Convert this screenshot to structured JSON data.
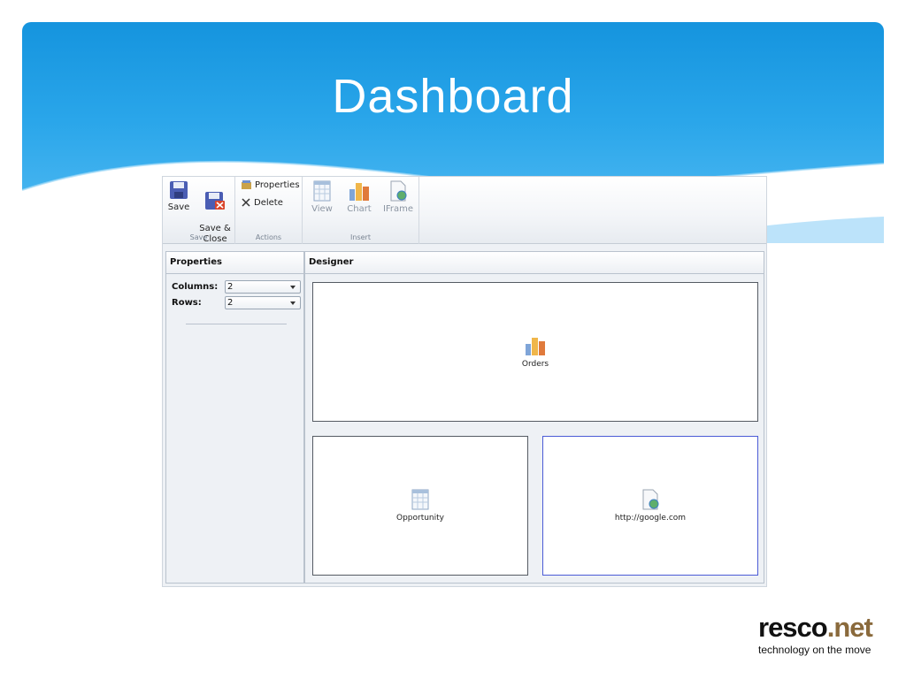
{
  "slide": {
    "title": "Dashboard"
  },
  "ribbon": {
    "save_group": {
      "label": "Save",
      "save": "Save",
      "save_close": "Save &\nClose"
    },
    "actions_group": {
      "label": "Actions",
      "properties": "Properties",
      "delete": "Delete"
    },
    "insert_group": {
      "label": "Insert",
      "view": "View",
      "chart": "Chart",
      "iframe": "IFrame"
    }
  },
  "properties_panel": {
    "title": "Properties",
    "columns_label": "Columns:",
    "columns_value": "2",
    "rows_label": "Rows:",
    "rows_value": "2"
  },
  "designer": {
    "title": "Designer",
    "tiles": [
      {
        "label": "Orders",
        "icon": "chart-icon"
      },
      {
        "label": "Opportunity",
        "icon": "view-grid-icon"
      },
      {
        "label": "http://google.com",
        "icon": "iframe-page-icon"
      }
    ]
  },
  "logo": {
    "main_a": "resco",
    "main_b": ".net",
    "tagline": "technology on the move"
  },
  "colors": {
    "banner": "#1594de",
    "accent_selected": "#4b5bd6",
    "logo_net": "#8a6a3c"
  }
}
